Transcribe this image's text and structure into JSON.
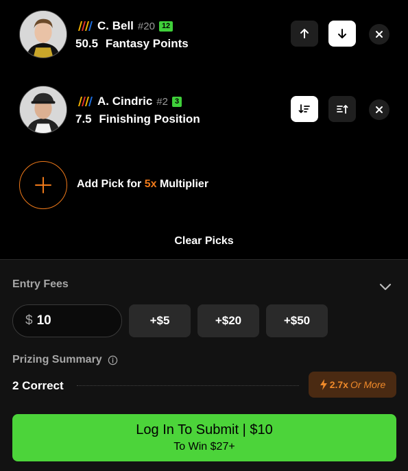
{
  "picks": [
    {
      "name": "C. Bell",
      "number": "#20",
      "badge": "12",
      "value": "50.5",
      "stat": "Fantasy Points",
      "buttons": [
        "arrow-up-icon",
        "arrow-down-icon"
      ],
      "active_button": 1
    },
    {
      "name": "A. Cindric",
      "number": "#2",
      "badge": "3",
      "value": "7.5",
      "stat": "Finishing Position",
      "buttons": [
        "sort-descending-icon",
        "sort-ascending-icon"
      ],
      "active_button": 0
    }
  ],
  "add_pick": {
    "prefix": "Add Pick for",
    "multiplier": "5x",
    "suffix": "Multiplier"
  },
  "clear_picks_label": "Clear Picks",
  "entry": {
    "label": "Entry Fees",
    "currency": "$",
    "amount": "10",
    "quick_adds": [
      "+$5",
      "+$20",
      "+$50"
    ]
  },
  "prizing": {
    "label": "Prizing Summary",
    "rows": [
      {
        "label": "2 Correct",
        "multiplier": "2.7x",
        "qualifier": "Or More"
      }
    ]
  },
  "submit": {
    "label": "Log In To Submit | $10",
    "sublabel": "To Win $27+"
  },
  "colors": {
    "accent_orange": "#f07a1a",
    "accent_green": "#4cd43a",
    "badge_green": "#3fd03a",
    "background": "#000000",
    "panel": "#121212"
  }
}
